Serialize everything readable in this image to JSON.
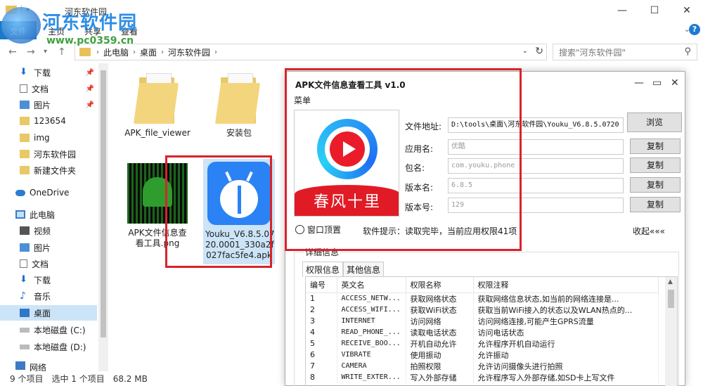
{
  "explorer": {
    "title": "河东软件园",
    "ribbon": {
      "file": "文件",
      "home": "主页",
      "share": "共享",
      "view": "查看"
    },
    "address": {
      "crumbs": [
        "此电脑",
        "桌面",
        "河东软件园"
      ]
    },
    "search_placeholder": "搜索\"河东软件园\"",
    "sidebar": [
      {
        "label": "下载",
        "icon": "download-icon",
        "pinned": true
      },
      {
        "label": "文档",
        "icon": "document-icon",
        "pinned": true
      },
      {
        "label": "图片",
        "icon": "picture-icon",
        "pinned": true
      },
      {
        "label": "123654",
        "icon": "folder-icon"
      },
      {
        "label": "img",
        "icon": "folder-icon"
      },
      {
        "label": "河东软件园",
        "icon": "folder-icon"
      },
      {
        "label": "新建文件夹",
        "icon": "folder-icon"
      },
      {
        "label": "OneDrive",
        "icon": "cloud-icon"
      },
      {
        "label": "此电脑",
        "icon": "computer-icon"
      },
      {
        "label": "视频",
        "icon": "video-icon"
      },
      {
        "label": "图片",
        "icon": "picture-icon"
      },
      {
        "label": "文档",
        "icon": "document-icon"
      },
      {
        "label": "下载",
        "icon": "download-icon"
      },
      {
        "label": "音乐",
        "icon": "music-icon"
      },
      {
        "label": "桌面",
        "icon": "desktop-icon",
        "selected": true
      },
      {
        "label": "本地磁盘 (C:)",
        "icon": "drive-icon"
      },
      {
        "label": "本地磁盘 (D:)",
        "icon": "drive-icon"
      },
      {
        "label": "网络",
        "icon": "network-icon"
      }
    ],
    "files": [
      {
        "name": "APK_file_viewer",
        "type": "folder"
      },
      {
        "name": "安装包",
        "type": "folder"
      },
      {
        "name": "APK文件信息查看工具.png",
        "line1": "APK文件信息查",
        "line2": "看工具.png",
        "type": "image"
      },
      {
        "name": "Youku_V6.8.5.0720.0001_330a2f027fac5fe4.apk",
        "line1": "Youku_V6.8.5.07",
        "line2": "20.0001_330a2f",
        "line3": "027fac5fe4.apk",
        "type": "apk"
      }
    ],
    "status": {
      "count": "9 个项目",
      "selected": "选中 1 个项目",
      "size": "68.2 MB"
    }
  },
  "dialog": {
    "title": "APK文件信息查看工具 v1.0",
    "menu": "菜单",
    "logo_caption": "春风十里",
    "fields": {
      "path_label": "文件地址:",
      "path_value": "D:\\tools\\桌面\\河东软件园\\Youku_V6.8.5.0720",
      "app_name_label": "应用名:",
      "app_name_value": "优酷",
      "package_label": "包名:",
      "package_value": "com.youku.phone",
      "version_name_label": "版本名:",
      "version_name_value": "6.8.5",
      "version_code_label": "版本号:",
      "version_code_value": "129"
    },
    "buttons": {
      "browse": "浏览",
      "copy": "复制"
    },
    "pin_top": "窗口顶置",
    "tip": "软件提示：读取完毕，当前应用权限41项",
    "collapse": "收起«««",
    "detail_group": "详细信息",
    "tabs": [
      "权限信息",
      "其他信息"
    ],
    "table": {
      "headers": [
        "编号",
        "英文名",
        "权限名称",
        "权限注释"
      ],
      "rows": [
        [
          "1",
          "ACCESS_NETW...",
          "获取网络状态",
          "获取网络信息状态,如当前的网络连接是..."
        ],
        [
          "2",
          "ACCESS_WIFI...",
          "获取WiFi状态",
          "获取当前WiFi接入的状态以及WLAN热点的..."
        ],
        [
          "3",
          "INTERNET",
          "访问网络",
          "访问网络连接,可能产生GPRS流量"
        ],
        [
          "4",
          "READ_PHONE_...",
          "读取电话状态",
          "访问电话状态"
        ],
        [
          "5",
          "RECEIVE_BOO...",
          "开机自动允许",
          "允许程序开机自动运行"
        ],
        [
          "6",
          "VIBRATE",
          "使用振动",
          "允许振动"
        ],
        [
          "7",
          "CAMERA",
          "拍照权限",
          "允许访问摄像头进行拍照"
        ],
        [
          "8",
          "WRITE_EXTER...",
          "写入外部存储",
          "允许程序写入外部存储,如SD卡上写文件"
        ]
      ]
    }
  },
  "watermark": {
    "name": "河东软件园",
    "url": "www.pc0359.cn"
  }
}
